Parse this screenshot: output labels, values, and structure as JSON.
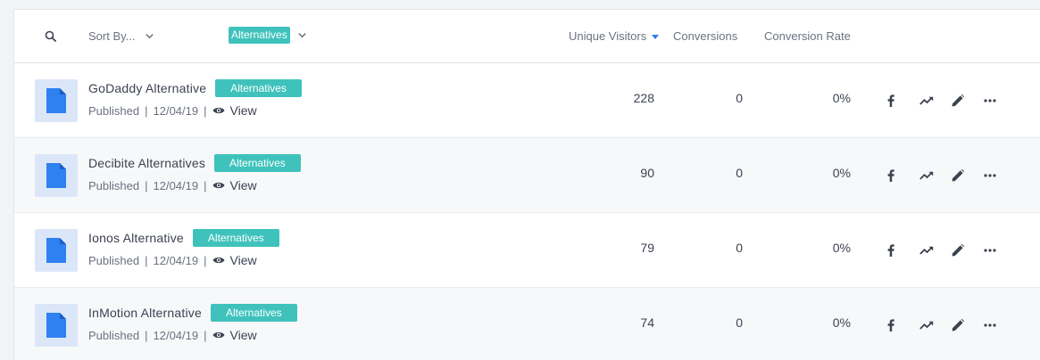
{
  "header": {
    "sort_label": "Sort By...",
    "filter_tag": "Alternatives",
    "columns": {
      "unique_visitors": "Unique Visitors",
      "conversions": "Conversions",
      "conversion_rate": "Conversion Rate"
    },
    "sort_column_indicator": "caret-down-icon",
    "accent_color": "#2f7be8"
  },
  "tag_color": "#3fc2bc",
  "rows": [
    {
      "title": "GoDaddy Alternative",
      "tag": "Alternatives",
      "status": "Published",
      "date": "12/04/19",
      "view_label": "View",
      "unique_visitors": "228",
      "conversions": "0",
      "conversion_rate": "0%"
    },
    {
      "title": "Decibite Alternatives",
      "tag": "Alternatives",
      "status": "Published",
      "date": "12/04/19",
      "view_label": "View",
      "unique_visitors": "90",
      "conversions": "0",
      "conversion_rate": "0%"
    },
    {
      "title": "Ionos Alternative",
      "tag": "Alternatives",
      "status": "Published",
      "date": "12/04/19",
      "view_label": "View",
      "unique_visitors": "79",
      "conversions": "0",
      "conversion_rate": "0%"
    },
    {
      "title": "InMotion Alternative",
      "tag": "Alternatives",
      "status": "Published",
      "date": "12/04/19",
      "view_label": "View",
      "unique_visitors": "74",
      "conversions": "0",
      "conversion_rate": "0%"
    }
  ],
  "row_actions": [
    "facebook-icon",
    "trend-icon",
    "edit-icon",
    "more-icon"
  ]
}
